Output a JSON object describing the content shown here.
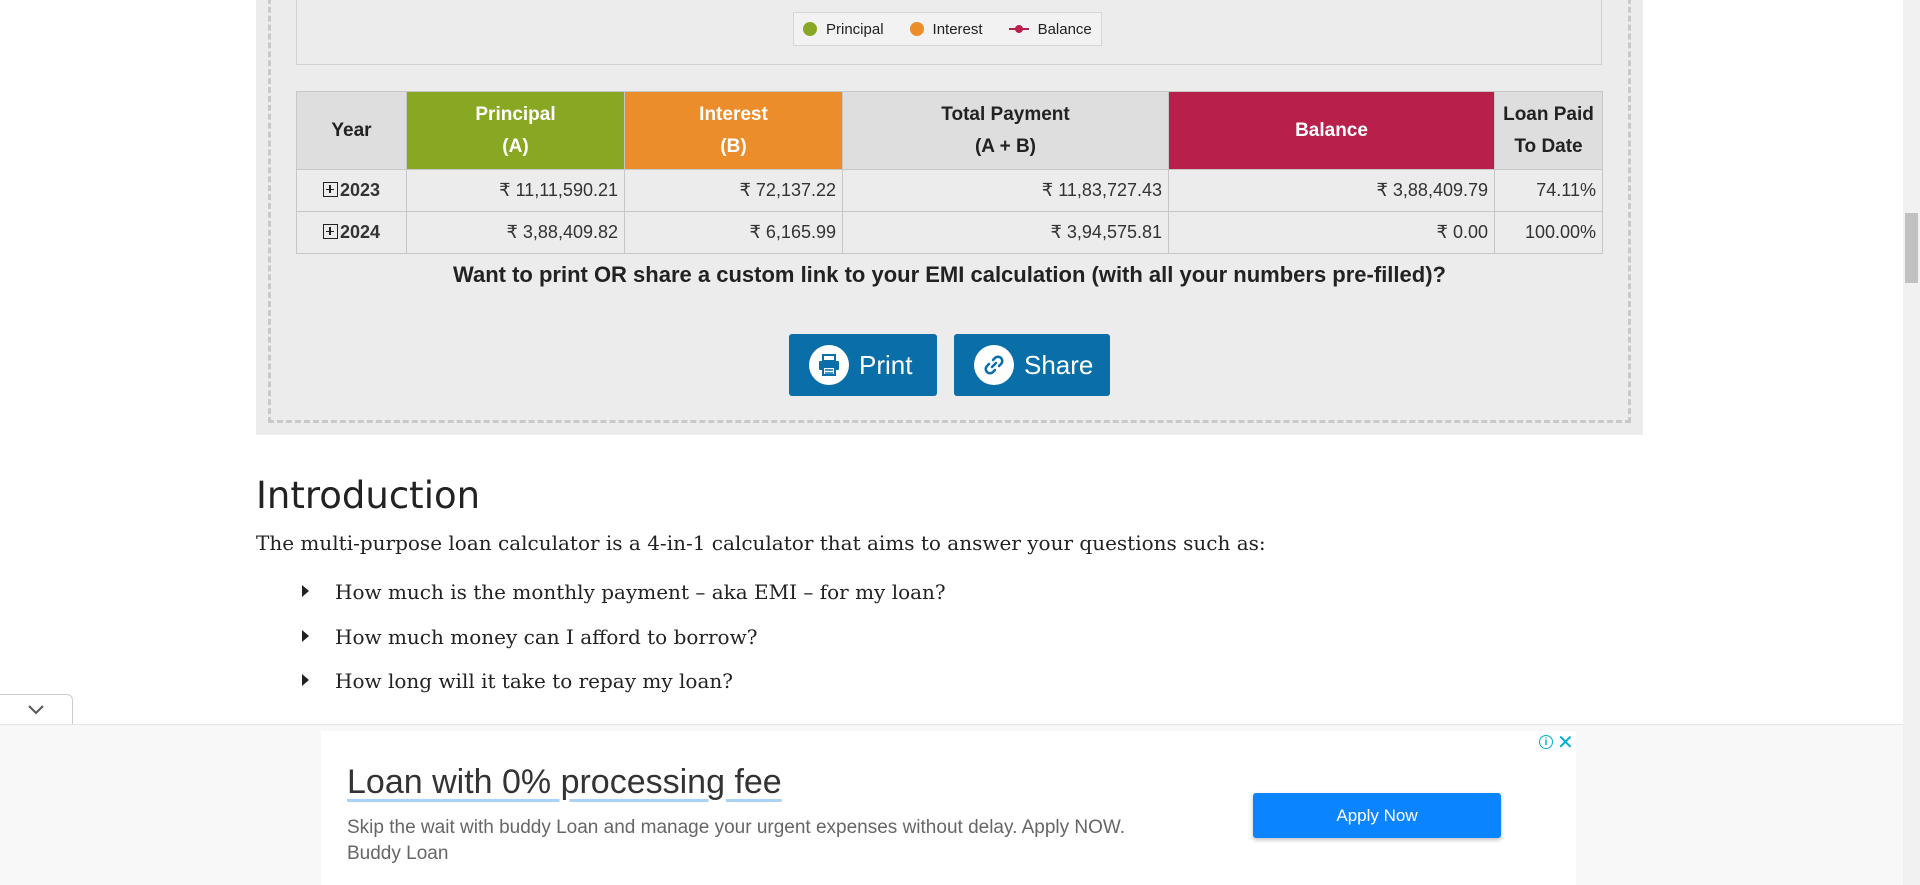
{
  "legend": {
    "principal": "Principal",
    "interest": "Interest",
    "balance": "Balance"
  },
  "table": {
    "headers": {
      "year": "Year",
      "principal_line1": "Principal",
      "principal_line2": "(A)",
      "interest_line1": "Interest",
      "interest_line2": "(B)",
      "total_line1": "Total Payment",
      "total_line2": "(A + B)",
      "balance": "Balance",
      "paid_line1": "Loan Paid",
      "paid_line2": "To Date"
    },
    "rows": [
      {
        "year": "2023",
        "principal": "₹ 11,11,590.21",
        "interest": "₹ 72,137.22",
        "total": "₹ 11,83,727.43",
        "balance": "₹ 3,88,409.79",
        "paid": "74.11%"
      },
      {
        "year": "2024",
        "principal": "₹ 3,88,409.82",
        "interest": "₹ 6,165.99",
        "total": "₹ 3,94,575.81",
        "balance": "₹ 0.00",
        "paid": "100.00%"
      }
    ]
  },
  "share": {
    "question": "Want to print OR share a custom link to your EMI calculation (with all your numbers pre-filled)?",
    "print_label": "Print",
    "share_label": "Share"
  },
  "article": {
    "title": "Introduction",
    "intro": "The multi-purpose loan calculator is a 4-in-1 calculator that aims to answer your questions such as:",
    "questions": [
      "How much is the monthly payment – aka EMI – for my loan?",
      "How much money can I afford to borrow?",
      "How long will it take to repay my loan?"
    ]
  },
  "ad": {
    "title": "Loan with 0% processing fee",
    "description": "Skip the wait with buddy Loan and manage your urgent expenses without delay. Apply NOW. Buddy Loan",
    "button_label": "Apply Now"
  },
  "colors": {
    "principal": "#88a824",
    "interest": "#ec8d2c",
    "balance": "#b81f4a",
    "button": "#0a6fa8",
    "ad_button": "#0b84ff"
  },
  "icons": {
    "print": "printer-icon",
    "share": "link-icon",
    "expand": "plus-box-icon",
    "collapse": "chevron-down-icon",
    "ad_info": "info-icon",
    "ad_close": "close-icon"
  }
}
